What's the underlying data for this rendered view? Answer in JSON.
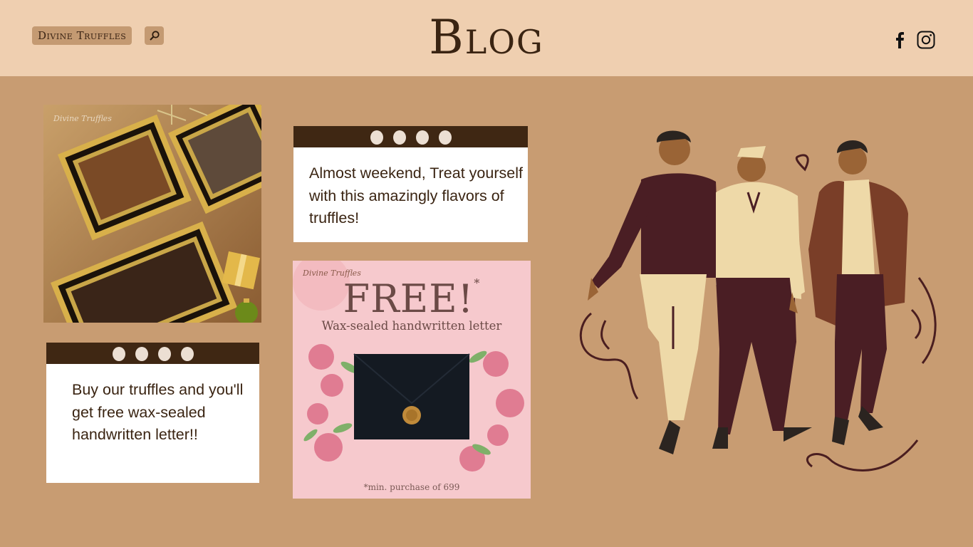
{
  "header": {
    "brand": "Divine Truffles",
    "title": "Blog",
    "search_icon": "search-icon",
    "social": [
      "facebook-icon",
      "instagram-icon"
    ]
  },
  "posts": {
    "note_top": "Almost weekend, Treat yourself with this amazingly flavors of truffles!",
    "note_bottom": "Buy our truffles and you'll get free wax-sealed handwritten letter!!"
  },
  "photo": {
    "logo": "Divine Truffles"
  },
  "promo": {
    "logo": "Divine Truffles",
    "headline": "FREE!",
    "asterisk": "*",
    "subtitle": "Wax-sealed handwritten letter",
    "fine_print": "*min. purchase of 699"
  },
  "colors": {
    "page_bg": "#c89c72",
    "header_bg": "#efcfb0",
    "note_bar": "#3f2713",
    "text_dark": "#3a2412",
    "promo_bg": "#f6c9cd"
  }
}
